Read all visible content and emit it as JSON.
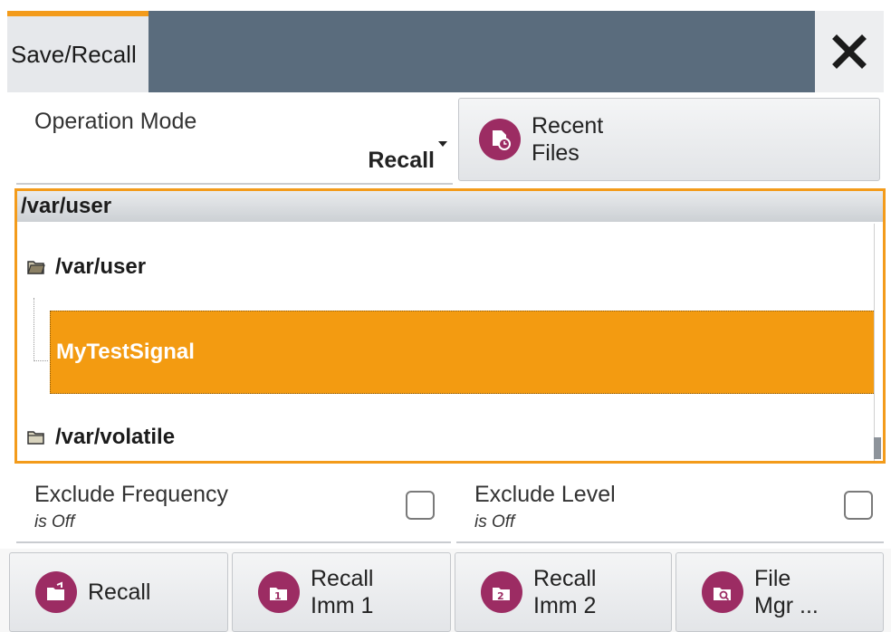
{
  "title": "Save/Recall",
  "close_symbol": "✕",
  "operation_mode": {
    "label": "Operation Mode",
    "value": "Recall"
  },
  "recent_files": {
    "line1": "Recent",
    "line2": "Files"
  },
  "path": "/var/user",
  "tree": {
    "root_user": "/var/user",
    "selected_file": "MyTestSignal",
    "root_volatile": "/var/volatile"
  },
  "exclude_frequency": {
    "label": "Exclude Frequency",
    "state": "is Off",
    "checked": false
  },
  "exclude_level": {
    "label": "Exclude Level",
    "state": "is Off",
    "checked": false
  },
  "toolbar": {
    "recall": "Recall",
    "imm1_line1": "Recall",
    "imm1_line2": "Imm 1",
    "imm2_line1": "Recall",
    "imm2_line2": "Imm 2",
    "filemgr_line1": "File",
    "filemgr_line2": "Mgr ..."
  },
  "colors": {
    "accent": "#f39b1b",
    "title_fill": "#5a6c7d",
    "icon_bg": "#9c2c63",
    "selection": "#f39b11"
  },
  "icons": [
    "close-icon",
    "recent-files-icon",
    "folder-open-icon",
    "folder-closed-icon",
    "recall-icon",
    "recall-imm1-icon",
    "recall-imm2-icon",
    "file-manager-icon"
  ]
}
